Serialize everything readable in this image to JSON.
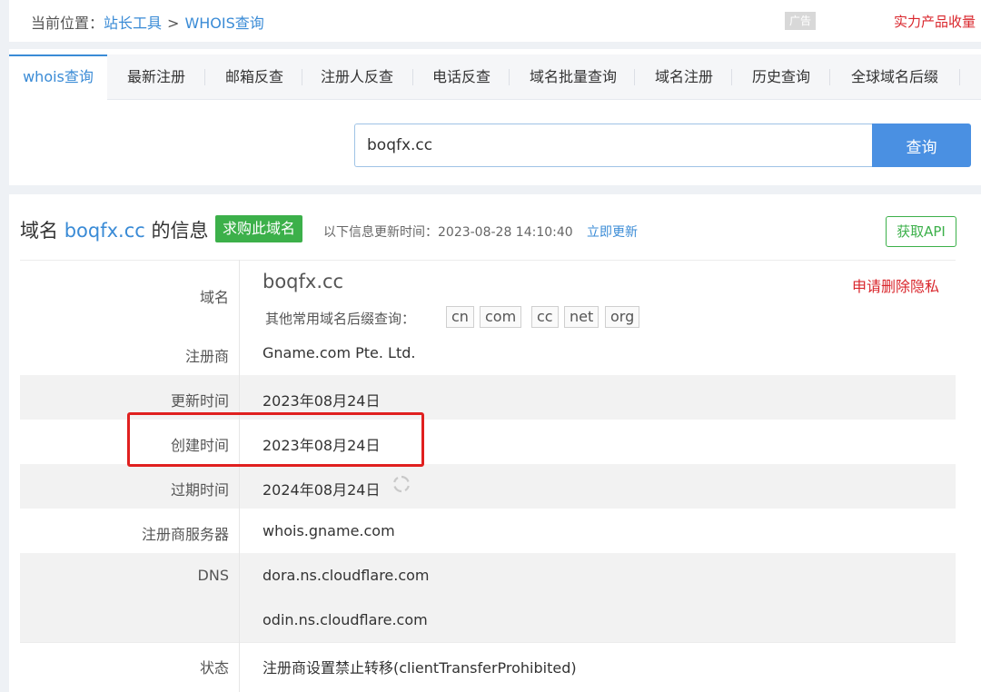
{
  "breadcrumb": {
    "prefix": "当前位置：",
    "home": "站长工具",
    "sep": ">",
    "current": "WHOIS查询"
  },
  "ad": {
    "tag": "广告",
    "text": "实力产品收量"
  },
  "tabs": [
    {
      "label": "whois查询",
      "active": true
    },
    {
      "label": "最新注册"
    },
    {
      "label": "邮箱反查"
    },
    {
      "label": "注册人反查"
    },
    {
      "label": "电话反查"
    },
    {
      "label": "域名批量查询"
    },
    {
      "label": "域名注册"
    },
    {
      "label": "历史查询"
    },
    {
      "label": "全球域名后缀"
    }
  ],
  "search": {
    "value": "boqfx.cc",
    "button": "查询"
  },
  "card": {
    "title_prefix": "域名 ",
    "domain": "boqfx.cc",
    "title_suffix": " 的信息",
    "buy_label": "求购此域名",
    "update_text": "以下信息更新时间：2023-08-28 14:10:40",
    "update_link": "立即更新",
    "api_label": "获取API"
  },
  "info": {
    "domain_label": "域名",
    "domain_value": "boqfx.cc",
    "delete_privacy": "申请删除隐私",
    "suffix_label": "其他常用域名后缀查询：",
    "suffixes": [
      "cn",
      "com",
      "cc",
      "net",
      "org"
    ],
    "registrar_label": "注册商",
    "registrar_value": "Gname.com Pte. Ltd.",
    "updated_label": "更新时间",
    "updated_value": "2023年08月24日",
    "created_label": "创建时间",
    "created_value": "2023年08月24日",
    "expires_label": "过期时间",
    "expires_value": "2024年08月24日",
    "whois_server_label": "注册商服务器",
    "whois_server_value": "whois.gname.com",
    "dns_label": "DNS",
    "dns": [
      "dora.ns.cloudflare.com",
      "odin.ns.cloudflare.com"
    ],
    "status_label": "状态",
    "status_value": "注册商设置禁止转移(clientTransferProhibited)"
  },
  "colors": {
    "accent": "#3a8bd6",
    "green": "#3cb04a",
    "red": "#d9262c",
    "highlight": "#e0201f"
  },
  "icons": {
    "refresh": "refresh-icon"
  }
}
